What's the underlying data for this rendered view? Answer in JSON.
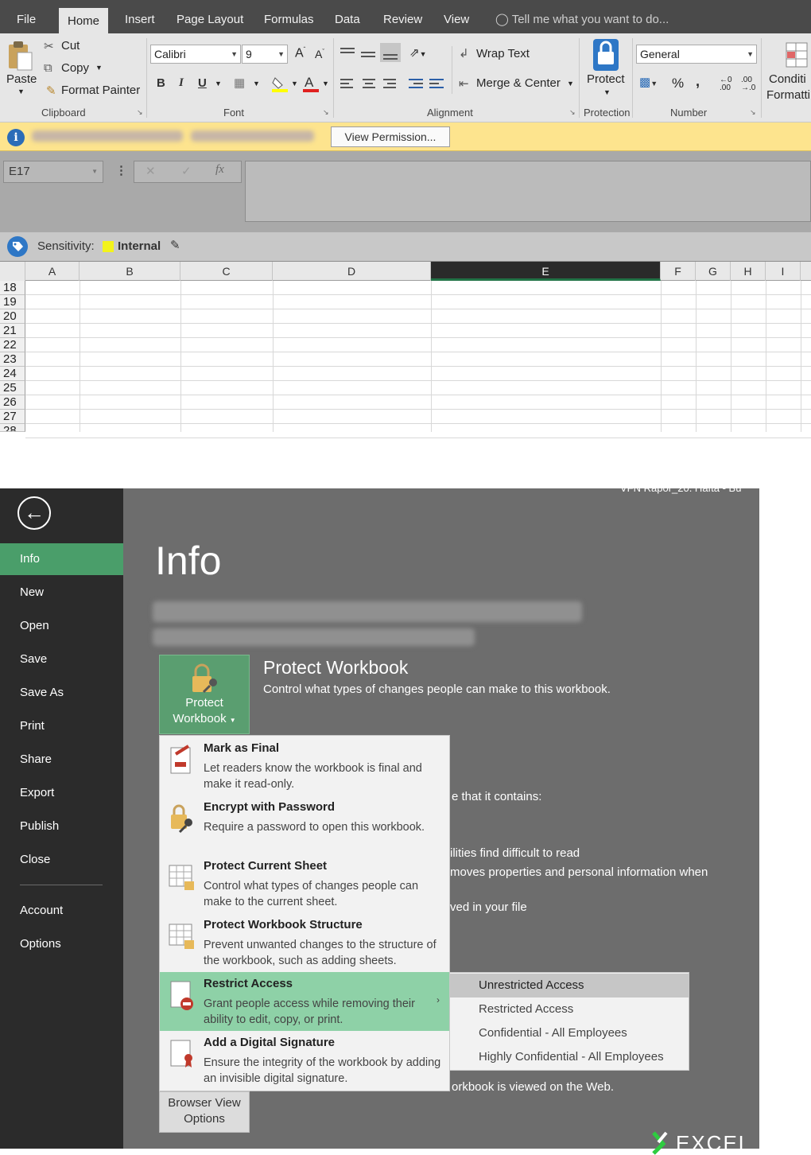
{
  "ribbon": {
    "tabs": [
      "File",
      "Home",
      "Insert",
      "Page Layout",
      "Formulas",
      "Data",
      "Review",
      "View"
    ],
    "tell_me": "Tell me what you want to do...",
    "clipboard": {
      "paste": "Paste",
      "cut": "Cut",
      "copy": "Copy",
      "format_painter": "Format Painter",
      "group": "Clipboard"
    },
    "font": {
      "name": "Calibri",
      "size": "9",
      "bold": "B",
      "italic": "I",
      "underline": "U",
      "group": "Font"
    },
    "alignment": {
      "wrap_text": "Wrap Text",
      "merge_center": "Merge & Center",
      "group": "Alignment"
    },
    "protection": {
      "protect": "Protect",
      "group": "Protection"
    },
    "number": {
      "format": "General",
      "percent": "%",
      "comma": ",",
      "group": "Number"
    },
    "styles": {
      "conditional_line1": "Conditi",
      "conditional_line2": "Formatti"
    }
  },
  "infobar": {
    "button": "View Permission..."
  },
  "formula_bar": {
    "name_box": "E17",
    "fx": "fx"
  },
  "sensitivity": {
    "label": "Sensitivity:",
    "value": "Internal",
    "color": "#f3f31c"
  },
  "grid": {
    "columns": [
      "A",
      "B",
      "C",
      "D",
      "E",
      "F",
      "G",
      "H",
      "I"
    ],
    "selected_column": "E",
    "rows": [
      "18",
      "19",
      "20",
      "21",
      "22",
      "23",
      "24",
      "25",
      "26",
      "27",
      "28"
    ]
  },
  "backstage": {
    "title_fragment": "VFN Rapor_20. Hafta - Bu",
    "nav": [
      "Info",
      "New",
      "Open",
      "Save",
      "Save As",
      "Print",
      "Share",
      "Export",
      "Publish",
      "Close",
      "Account",
      "Options"
    ],
    "active_nav": "Info",
    "page_title": "Info",
    "protect": {
      "button_line1": "Protect",
      "button_line2": "Workbook",
      "title": "Protect Workbook",
      "description": "Control what types of changes people can make to this workbook."
    },
    "bg_text": [
      "e that it contains:",
      "ilities find difficult to read",
      "moves properties and personal information when",
      "ved in your file",
      "orkbook is viewed on the Web."
    ],
    "browser_view": {
      "line1": "Browser View",
      "line2": "Options"
    }
  },
  "menu": [
    {
      "title": "Mark as Final",
      "desc": "Let readers know the workbook is final and make it read-only.",
      "icon": "mark-final-icon"
    },
    {
      "title": "Encrypt with Password",
      "desc": "Require a password to open this workbook.",
      "icon": "lock-key-icon"
    },
    {
      "title": "Protect Current Sheet",
      "desc": "Control what types of changes people can make to the current sheet.",
      "icon": "sheet-lock-icon"
    },
    {
      "title": "Protect Workbook Structure",
      "desc": "Prevent unwanted changes to the structure of the workbook, such as adding sheets.",
      "icon": "structure-lock-icon"
    },
    {
      "title": "Restrict Access",
      "desc": "Grant people access while removing their ability to edit, copy, or print.",
      "icon": "restrict-icon"
    },
    {
      "title": "Add a Digital Signature",
      "desc": "Ensure the integrity of the workbook by adding an invisible digital signature.",
      "icon": "signature-icon"
    }
  ],
  "submenu": [
    "Unrestricted Access",
    "Restricted Access",
    "Confidential - All Employees",
    "Highly Confidential - All Employees"
  ],
  "watermark": "EXCEL DEPO"
}
